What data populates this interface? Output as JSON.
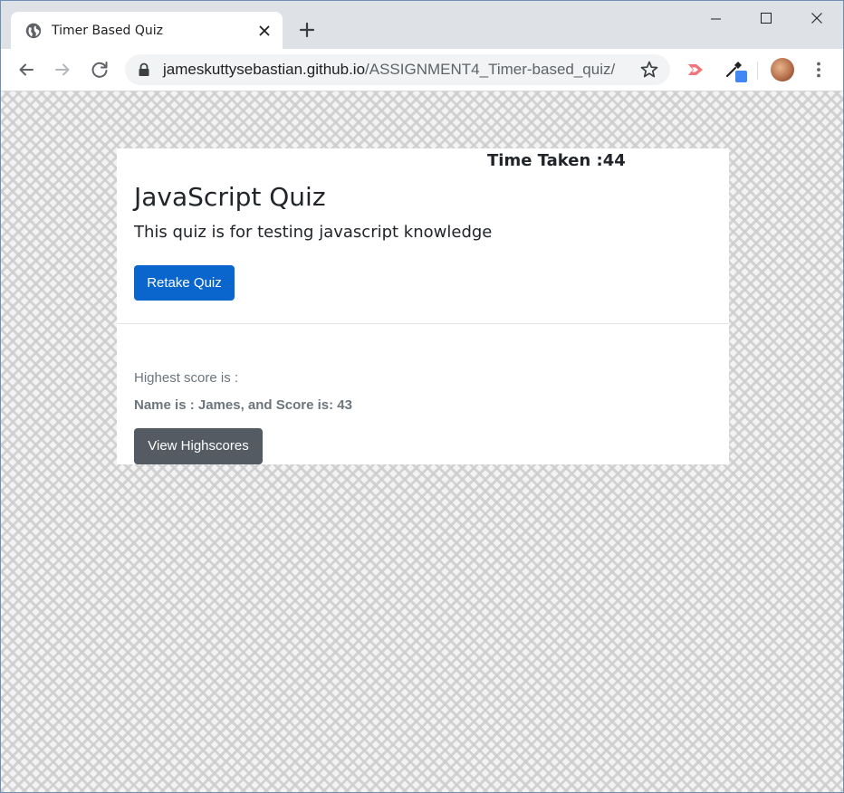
{
  "browser": {
    "tab_title": "Timer Based Quiz",
    "url_host": "jameskuttysebastian.github.io",
    "url_path": "/ASSIGNMENT4_Timer-based_quiz/",
    "tab_icon": "globe-icon",
    "toolbar_icons": [
      "back-arrow-icon",
      "forward-arrow-icon",
      "reload-icon",
      "lock-icon",
      "star-icon",
      "extension-icon",
      "eyedropper-icon",
      "avatar",
      "menu-dots-icon"
    ],
    "window_controls": [
      "minimize-icon",
      "maximize-icon",
      "close-icon"
    ]
  },
  "quiz": {
    "timer_text": "Time Taken :44",
    "title": "JavaScript Quiz",
    "subtitle": "This quiz is for testing javascript knowledge",
    "retake_label": "Retake Quiz",
    "highscore_label": "Highest score is :",
    "highscore_value": "Name is : James, and Score is: 43",
    "view_highscores_label": "View Highscores"
  },
  "colors": {
    "primary_button": "#0a66cc",
    "secondary_button": "#545b62",
    "muted_text": "#6c757d"
  }
}
